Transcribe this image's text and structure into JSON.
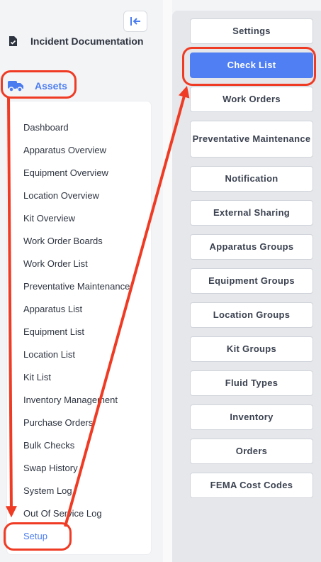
{
  "sidebar": {
    "top_item": {
      "label": "Incident Documentation",
      "icon": "document-icon"
    },
    "assets": {
      "label": "Assets",
      "icon": "truck-icon",
      "accent": "#4a7cf0"
    },
    "collapse_icon": "collapse-left-icon",
    "submenu": [
      "Dashboard",
      "Apparatus Overview",
      "Equipment Overview",
      "Location Overview",
      "Kit Overview",
      "Work Order Boards",
      "Work Order List",
      "Preventative Maintenance",
      "Apparatus List",
      "Equipment List",
      "Location List",
      "Kit List",
      "Inventory Management",
      "Purchase Orders",
      "Bulk Checks",
      "Swap History",
      "System Log",
      "Out Of Service Log",
      "Setup"
    ],
    "active_item": "Setup"
  },
  "setup_menu": {
    "buttons": [
      "Settings",
      "Check List",
      "Work Orders",
      "Preventative Maintenance",
      "Notification",
      "External Sharing",
      "Apparatus Groups",
      "Equipment Groups",
      "Location Groups",
      "Kit Groups",
      "Fluid Types",
      "Inventory",
      "Orders",
      "FEMA Cost Codes"
    ],
    "selected": "Check List",
    "selected_color": "#4f7ff2"
  },
  "annotation_color": "#ef3b24"
}
